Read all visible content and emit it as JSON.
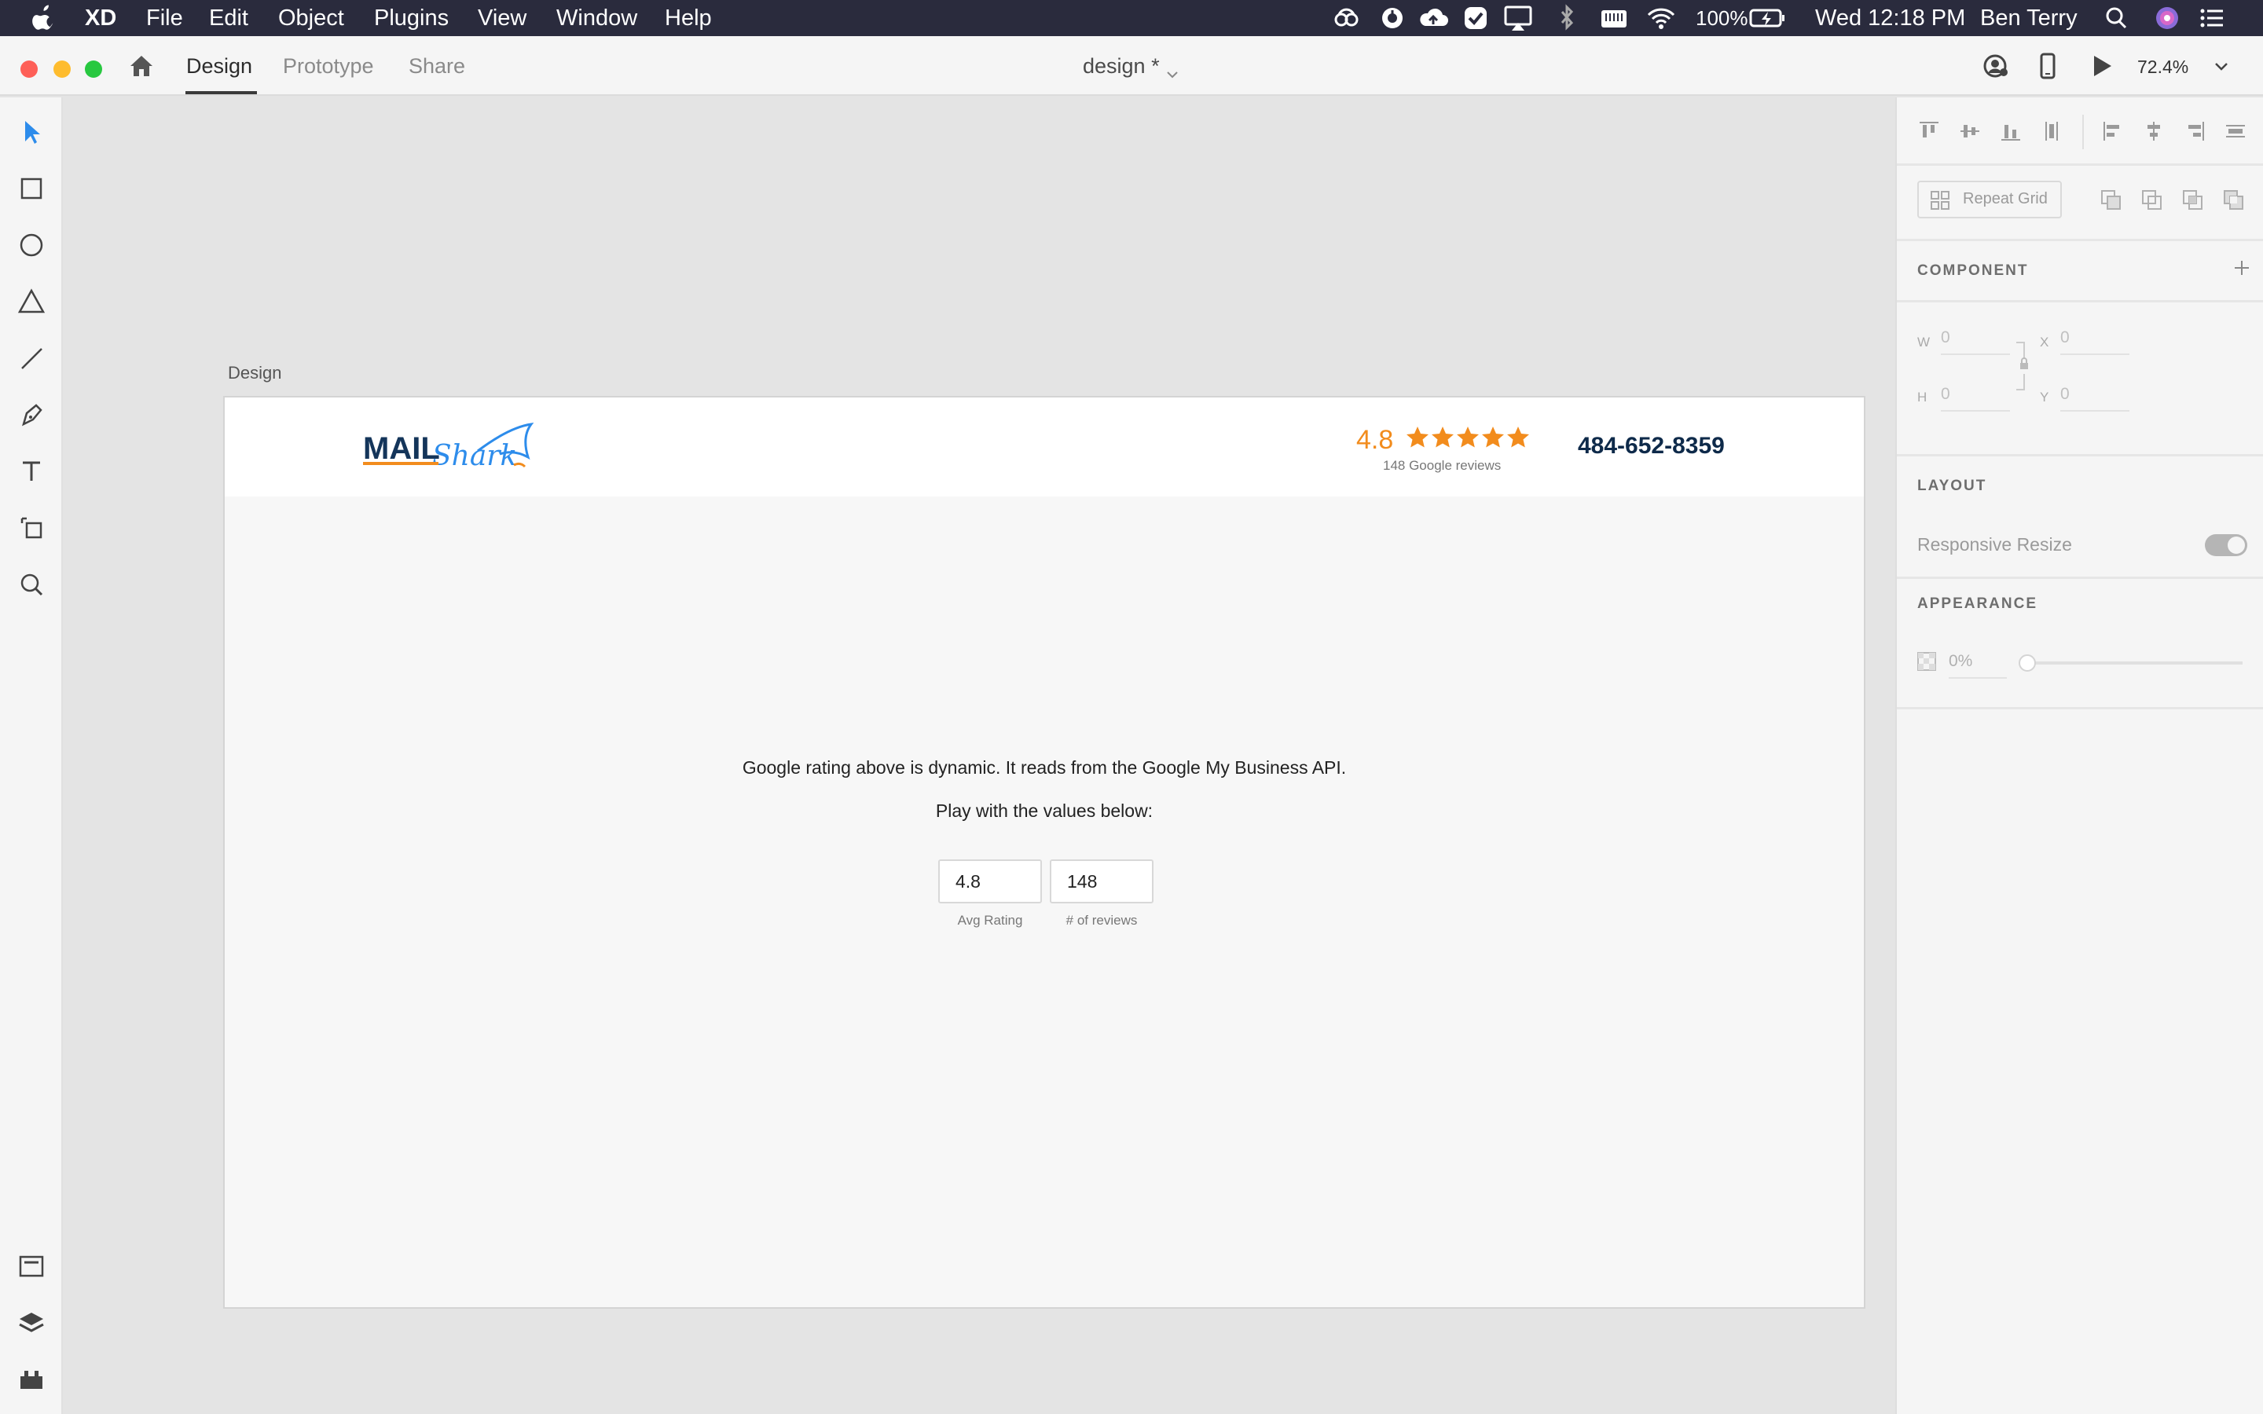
{
  "menubar": {
    "app_name": "XD",
    "items": [
      "File",
      "Edit",
      "Object",
      "Plugins",
      "View",
      "Window",
      "Help"
    ],
    "battery": "100%",
    "clock": "Wed 12:18 PM",
    "user": "Ben Terry",
    "status_icons": [
      "creative-cloud-icon",
      "sync-icon",
      "cloud-upload-icon",
      "checkmark-icon",
      "airplay-icon",
      "bluetooth-icon",
      "keyboard-icon",
      "wifi-icon",
      "battery-icon",
      "spotlight-search-icon",
      "siri-icon",
      "notification-center-icon"
    ]
  },
  "toolbar": {
    "tabs": [
      "Design",
      "Prototype",
      "Share"
    ],
    "active_tab": "Design",
    "document_title": "design *",
    "zoom": "72.4%"
  },
  "tools": [
    "select-tool-icon",
    "rectangle-tool-icon",
    "ellipse-tool-icon",
    "polygon-tool-icon",
    "line-tool-icon",
    "pen-tool-icon",
    "text-tool-icon",
    "artboard-tool-icon",
    "zoom-tool-icon",
    "assets-icon",
    "layers-icon",
    "plugins-icon"
  ],
  "artboard": {
    "label": "Design",
    "header": {
      "rating": "4.8",
      "stars": 5,
      "reviews_text": "148 Google reviews",
      "phone": "484-652-8359"
    },
    "message_line1": "Google rating above is dynamic. It reads from the Google My Business API.",
    "message_line2": "Play with the values below:",
    "inputs": [
      {
        "value": "4.8",
        "caption": "Avg Rating"
      },
      {
        "value": "148",
        "caption": "# of reviews"
      }
    ]
  },
  "panel": {
    "repeat_grid": "Repeat Grid",
    "component_label": "COMPONENT",
    "w_label": "W",
    "w_value": "0",
    "h_label": "H",
    "h_value": "0",
    "x_label": "X",
    "x_value": "0",
    "y_label": "Y",
    "y_value": "0",
    "layout_label": "LAYOUT",
    "responsive_resize": "Responsive Resize",
    "responsive_resize_on": true,
    "appearance_label": "APPEARANCE",
    "opacity": "0%"
  },
  "colors": {
    "menubar_bg": "#2a2b3d",
    "accent": "#2d8ceb",
    "rating_orange": "#f28c1d",
    "phone_navy": "#0e2a4a",
    "close": "#fe5f57",
    "minimize": "#febc2e",
    "zoom": "#28c840"
  }
}
